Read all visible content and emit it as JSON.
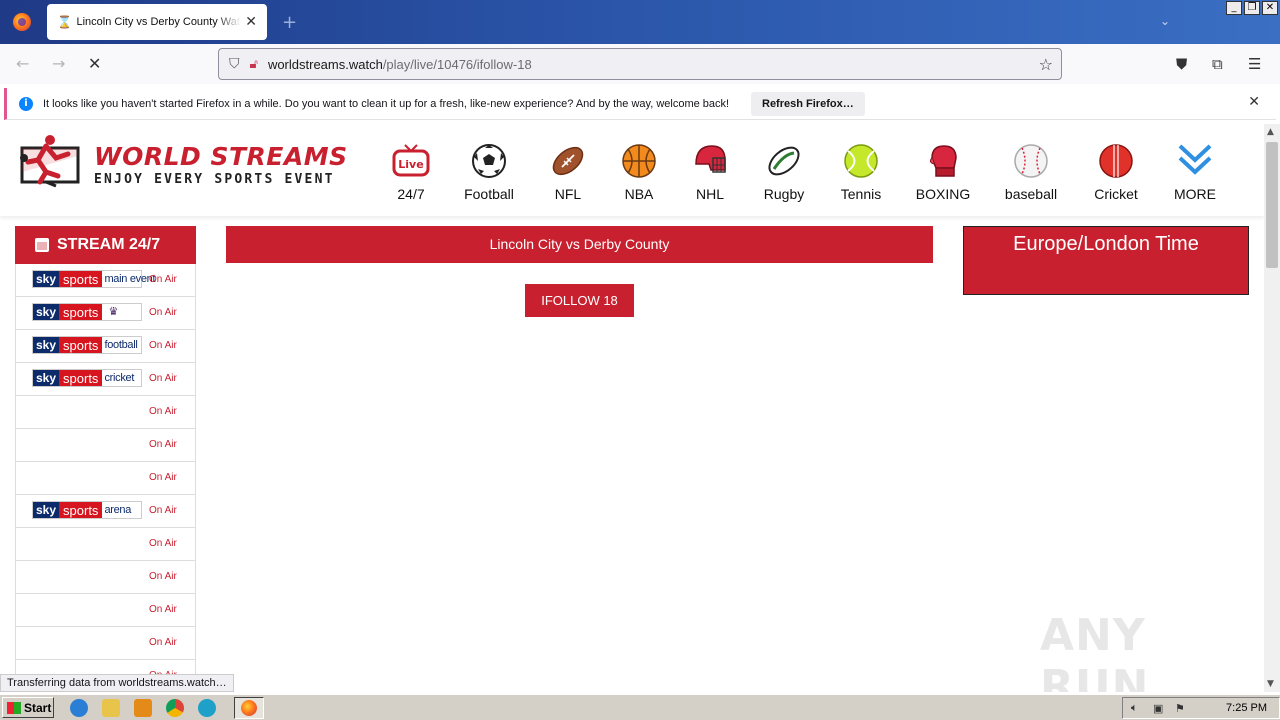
{
  "browser": {
    "tab_title": "Lincoln City vs Derby County Watch",
    "tab_icon": "hourglass-icon",
    "url_host": "worldstreams.watch",
    "url_path": "/play/live/10476/ifollow-18",
    "notification": {
      "message": "It looks like you haven't started Firefox in a while. Do you want to clean it up for a fresh, like-new experience? And by the way, welcome back!",
      "button": "Refresh Firefox…"
    },
    "status_text": "Transferring data from worldstreams.watch…"
  },
  "site": {
    "logo_line1": "WORLD STREAMS",
    "logo_line2": "ENJOY EVERY SPORTS EVENT",
    "brand_color": "#c8202e",
    "nav": [
      {
        "label": "24/7",
        "icon": "live-tv-icon"
      },
      {
        "label": "Football",
        "icon": "soccer-ball-icon"
      },
      {
        "label": "NFL",
        "icon": "american-football-icon"
      },
      {
        "label": "NBA",
        "icon": "basketball-icon"
      },
      {
        "label": "NHL",
        "icon": "hockey-helmet-icon"
      },
      {
        "label": "Rugby",
        "icon": "rugby-ball-icon"
      },
      {
        "label": "Tennis",
        "icon": "tennis-ball-icon"
      },
      {
        "label": "BOXING",
        "icon": "boxing-glove-icon"
      },
      {
        "label": "baseball",
        "icon": "baseball-icon"
      },
      {
        "label": "Cricket",
        "icon": "cricket-ball-icon"
      },
      {
        "label": "MORE",
        "icon": "chevron-down-icon"
      }
    ],
    "sidebar": {
      "title": "STREAM 24/7",
      "channels": [
        {
          "logo_a": "sky",
          "logo_b": "sports",
          "logo_c": "main event",
          "status": "On Air"
        },
        {
          "logo_a": "sky",
          "logo_b": "sports",
          "logo_c": "",
          "status": "On Air"
        },
        {
          "logo_a": "sky",
          "logo_b": "sports",
          "logo_c": "football",
          "status": "On Air"
        },
        {
          "logo_a": "sky",
          "logo_b": "sports",
          "logo_c": "cricket",
          "status": "On Air"
        },
        {
          "logo_a": "",
          "logo_b": "",
          "logo_c": "",
          "status": "On Air"
        },
        {
          "logo_a": "",
          "logo_b": "",
          "logo_c": "",
          "status": "On Air"
        },
        {
          "logo_a": "",
          "logo_b": "",
          "logo_c": "",
          "status": "On Air"
        },
        {
          "logo_a": "sky",
          "logo_b": "sports",
          "logo_c": "arena",
          "status": "On Air"
        },
        {
          "logo_a": "",
          "logo_b": "",
          "logo_c": "",
          "status": "On Air"
        },
        {
          "logo_a": "",
          "logo_b": "",
          "logo_c": "",
          "status": "On Air"
        },
        {
          "logo_a": "",
          "logo_b": "",
          "logo_c": "",
          "status": "On Air"
        },
        {
          "logo_a": "",
          "logo_b": "",
          "logo_c": "",
          "status": "On Air"
        },
        {
          "logo_a": "",
          "logo_b": "",
          "logo_c": "",
          "status": "On Air"
        }
      ]
    },
    "match_title": "Lincoln City vs Derby County",
    "stream_button": "IFOLLOW 18",
    "timezone_title": "Europe/London Time"
  },
  "watermark": "ANY RUN",
  "taskbar": {
    "start_label": "Start",
    "clock": "7:25 PM"
  }
}
